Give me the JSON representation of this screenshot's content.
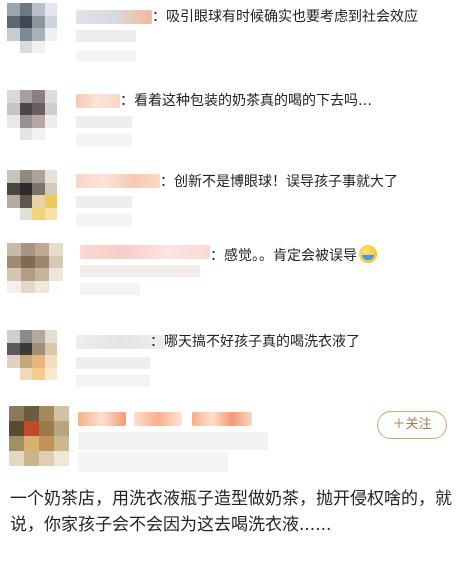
{
  "comments": [
    {
      "text": "：吸引眼球有时候确实也要考虑到社会效应"
    },
    {
      "text": "：看着这种包装的奶茶真的喝的下去吗…"
    },
    {
      "text": "：创新不是博眼球！误导孩子事就大了"
    },
    {
      "text": "：感觉。。肯定会被误导"
    },
    {
      "text": "：哪天搞不好孩子真的喝洗衣液了"
    }
  ],
  "post": {
    "follow_label": "＋关注",
    "text": "一个奶茶店，用洗衣液瓶子造型做奶茶，抛开侵权啥的，就说，你家孩子会不会因为这去喝洗衣液......"
  },
  "icons": {
    "comment4_emoji": "crying-laughing-emoji-icon"
  },
  "colors": {
    "follow_border": "#c9a57a",
    "follow_text": "#a07a52"
  }
}
